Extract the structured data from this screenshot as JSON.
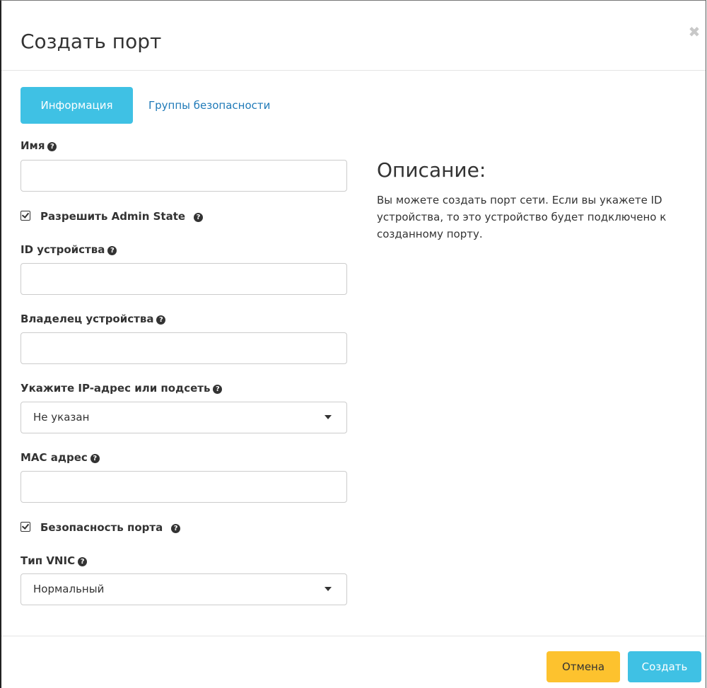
{
  "modal": {
    "title": "Создать порт",
    "close_icon": "close-icon"
  },
  "tabs": [
    {
      "label": "Информация",
      "active": true
    },
    {
      "label": "Группы безопасности",
      "active": false
    }
  ],
  "form": {
    "name": {
      "label": "Имя",
      "value": ""
    },
    "admin_state": {
      "label": "Разрешить Admin State",
      "checked": true
    },
    "device_id": {
      "label": "ID устройства",
      "value": ""
    },
    "device_owner": {
      "label": "Владелец устройства",
      "value": ""
    },
    "ip_subnet": {
      "label": "Укажите IP-адрес или подсеть",
      "selected": "Не указан"
    },
    "mac": {
      "label": "MAC адрес",
      "value": ""
    },
    "port_security": {
      "label": "Безопасность порта",
      "checked": true
    },
    "vnic_type": {
      "label": "Тип VNIC",
      "selected": "Нормальный"
    }
  },
  "description": {
    "title": "Описание:",
    "text": "Вы можете создать порт сети. Если вы укажете ID устройства, то это устройство будет подключено к созданному порту."
  },
  "footer": {
    "cancel_label": "Отмена",
    "create_label": "Создать"
  },
  "colors": {
    "primary": "#3fc1e4",
    "warning": "#fdc22e",
    "link": "#1f7ab8"
  }
}
